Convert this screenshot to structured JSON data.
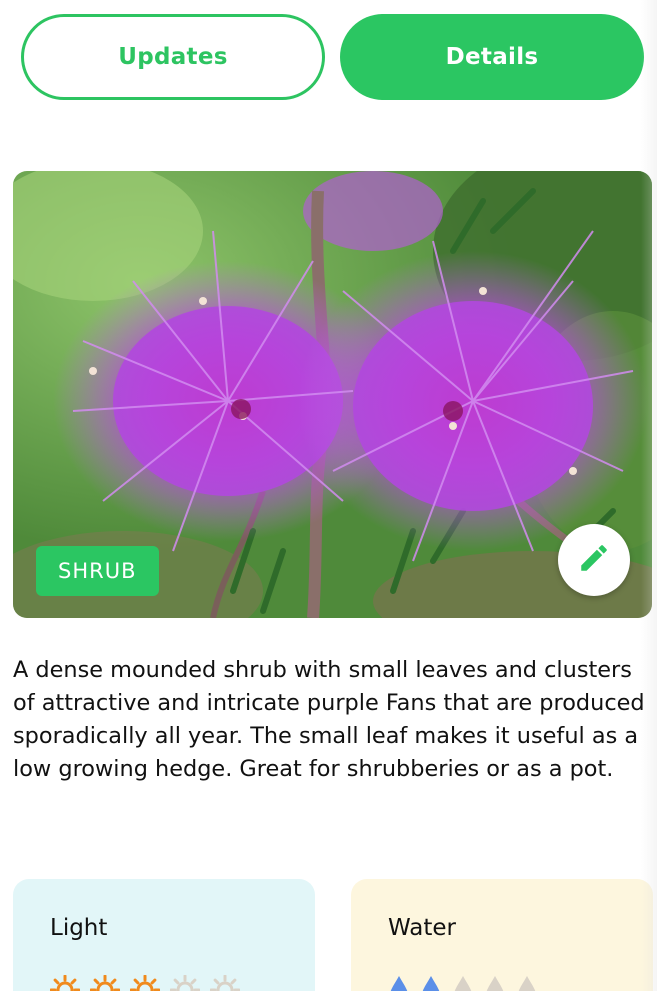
{
  "tabs": [
    {
      "label": "Updates",
      "active": false
    },
    {
      "label": "Details",
      "active": true
    }
  ],
  "plant": {
    "category": "SHRUB",
    "description": "A dense mounded shrub with small leaves and clusters of attractive and intricate purple Fans that are produced sporadically all year. The small leaf makes it useful as a low growing hedge. Great for shrubberies or as a pot."
  },
  "cards": {
    "light": {
      "title": "Light",
      "rating": 3,
      "max": 5,
      "icon": "sun-icon",
      "active_color": "#f08a1c",
      "inactive_color": "#d9d2c7"
    },
    "water": {
      "title": "Water",
      "rating": 2,
      "max": 5,
      "icon": "water-drop-icon",
      "active_color": "#5b8fe8",
      "inactive_color": "#d9d2c7"
    }
  },
  "colors": {
    "accent": "#2bc662",
    "light_card_bg": "#e2f6f8",
    "water_card_bg": "#fdf6de"
  }
}
